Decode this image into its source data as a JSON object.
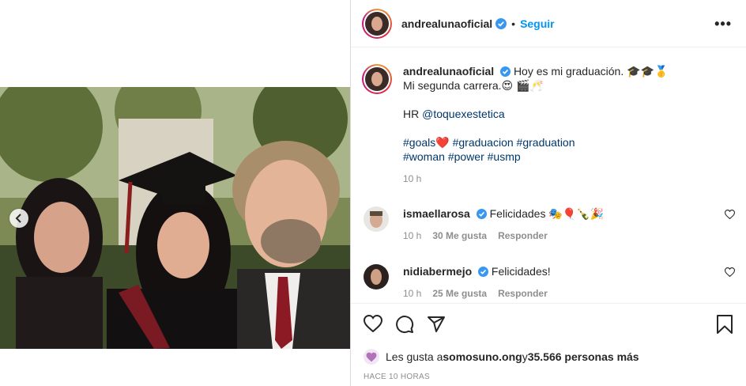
{
  "post": {
    "username": "andrealunaoficial",
    "follow_label": "Seguir",
    "separator": "•",
    "more_label": "•••"
  },
  "caption": {
    "username": "andrealunaoficial",
    "line1": "Hoy es mi graduación. 🎓🎓🥇",
    "line2": "Mi segunda carrera.😍 🎬🥂",
    "hr_prefix": "HR ",
    "hr_mention": "@toquexestetica",
    "tags_line1": [
      "#goals",
      "❤️",
      "#graduacion",
      "#graduation"
    ],
    "tags_line2": [
      "#woman",
      "#power",
      "#usmp"
    ],
    "time": "10 h"
  },
  "comments": [
    {
      "username": "ismaellarosa",
      "text": "Felicidades 🎭🎈🍾🎉",
      "time": "10 h",
      "likes": "30 Me gusta",
      "reply": "Responder"
    },
    {
      "username": "nidiabermejo",
      "text": "Felicidades!",
      "time": "10 h",
      "likes": "25 Me gusta",
      "reply": "Responder"
    }
  ],
  "likes": {
    "prefix": "Les gusta a ",
    "user": "somosuno.ong",
    "middle": " y ",
    "count": "35.566 personas más"
  },
  "timestamp": "HACE 10 HORAS",
  "colors": {
    "accent": "#0095f6",
    "verified": "#3897f0",
    "link": "#00376b",
    "muted": "#8e8e8e"
  },
  "icons": [
    "chevron-left-icon",
    "verified-icon",
    "heart-icon",
    "comment-icon",
    "share-icon",
    "bookmark-icon",
    "more-icon"
  ]
}
